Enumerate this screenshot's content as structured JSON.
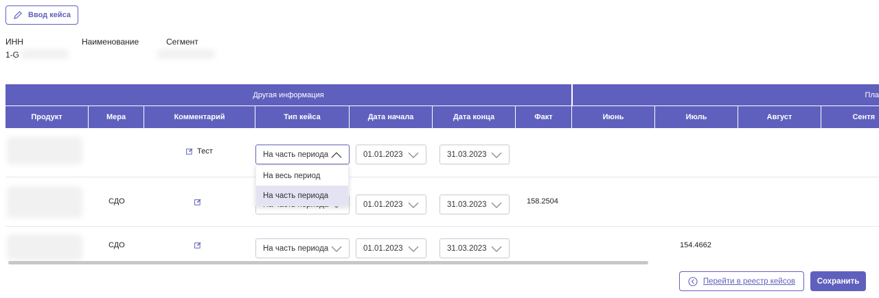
{
  "toolbar": {
    "case_button_label": "Ввод кейса"
  },
  "meta": {
    "inn_label": "ИНН",
    "name_label": "Наименование",
    "segment_label": "Сегмент",
    "inn_value_visible": "1-G"
  },
  "table": {
    "group_headers": [
      "Другая информация",
      "Пла"
    ],
    "columns": [
      "Продукт",
      "Мера",
      "Комментарий",
      "Тип кейса",
      "Дата начала",
      "Дата конца",
      "Факт",
      "Июнь",
      "Июль",
      "Август",
      "Сентя"
    ],
    "rows": [
      {
        "product": "",
        "measure": "",
        "comment": "Тест",
        "case_type": "На часть периода",
        "date_start": "01.01.2023",
        "date_end": "31.03.2023",
        "fact": "",
        "jun": "",
        "jul": ""
      },
      {
        "product": "",
        "measure": "СДО",
        "comment": "",
        "case_type": "На часть периода",
        "date_start": "01.01.2023",
        "date_end": "31.03.2023",
        "fact": "158.2504",
        "jun": "",
        "jul": ""
      },
      {
        "product": "",
        "measure": "СДО",
        "comment": "",
        "case_type": "На часть периода",
        "date_start": "01.01.2023",
        "date_end": "31.03.2023",
        "fact": "",
        "jun": "",
        "jul": "154.4662"
      }
    ]
  },
  "dropdown": {
    "options": [
      "На весь период",
      "На часть периода"
    ],
    "selected": "На часть периода"
  },
  "footer": {
    "registry_button_label": "Перейти в реестр кейсов",
    "save_button_label": "Сохранить"
  },
  "colors": {
    "accent": "#5f60bd",
    "selected_option_bg": "#e3e3f4"
  },
  "icons": [
    "pencil-icon",
    "edit-icon",
    "chevron-down-icon",
    "chevron-up-icon",
    "arrow-left-circle-icon"
  ]
}
